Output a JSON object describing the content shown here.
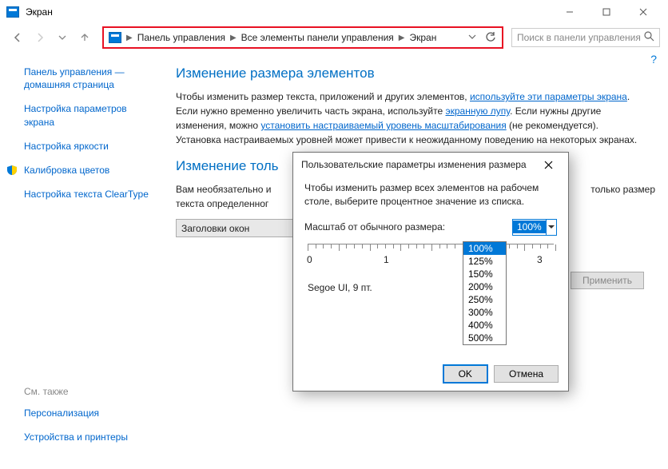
{
  "window": {
    "title": "Экран"
  },
  "breadcrumb": {
    "b1": "Панель управления",
    "b2": "Все элементы панели управления",
    "b3": "Экран"
  },
  "search": {
    "placeholder": "Поиск в панели управления"
  },
  "sidebar": {
    "home1": "Панель управления —",
    "home2": "домашняя страница",
    "l1": "Настройка параметров экрана",
    "l2": "Настройка яркости",
    "l3": "Калибровка цветов",
    "l4": "Настройка текста ClearType"
  },
  "footer": {
    "hdr": "См. также",
    "l1": "Персонализация",
    "l2": "Устройства и принтеры"
  },
  "main": {
    "h": "Изменение размера элементов",
    "p_before_link1": "Чтобы изменить размер текста, приложений и других элементов, ",
    "link1": "используйте эти параметры экрана",
    "p_mid1": ". Если нужно временно увеличить часть экрана, используйте ",
    "link2": "экранную лупу",
    "p_mid2": ". Если нужны другие изменения, можно ",
    "link3": "установить настраиваемый уровень масштабирования",
    "p_after": " (не рекомендуется). Установка настраиваемых уровней может привести к неожиданному поведению на некоторых экранах.",
    "sub_h": "Изменение толь",
    "sub_desc_a": "Вам необязательно и",
    "sub_desc_b": "текста определенног",
    "combo_label": "Заголовки окон",
    "apply": "Применить",
    "trailing_text": "только размер"
  },
  "modal": {
    "title": "Пользовательские параметры изменения размера",
    "desc": "Чтобы изменить размер всех элементов на рабочем столе, выберите процентное значение из списка.",
    "scale_label": "Масштаб от обычного размера:",
    "scale_value": "100%",
    "options": [
      "100%",
      "125%",
      "150%",
      "200%",
      "250%",
      "300%",
      "400%",
      "500%"
    ],
    "ruler": {
      "n0": "0",
      "n1": "1",
      "n3": "3"
    },
    "font_sample": "Segoe UI, 9 пт.",
    "ok": "OK",
    "cancel": "Отмена"
  }
}
